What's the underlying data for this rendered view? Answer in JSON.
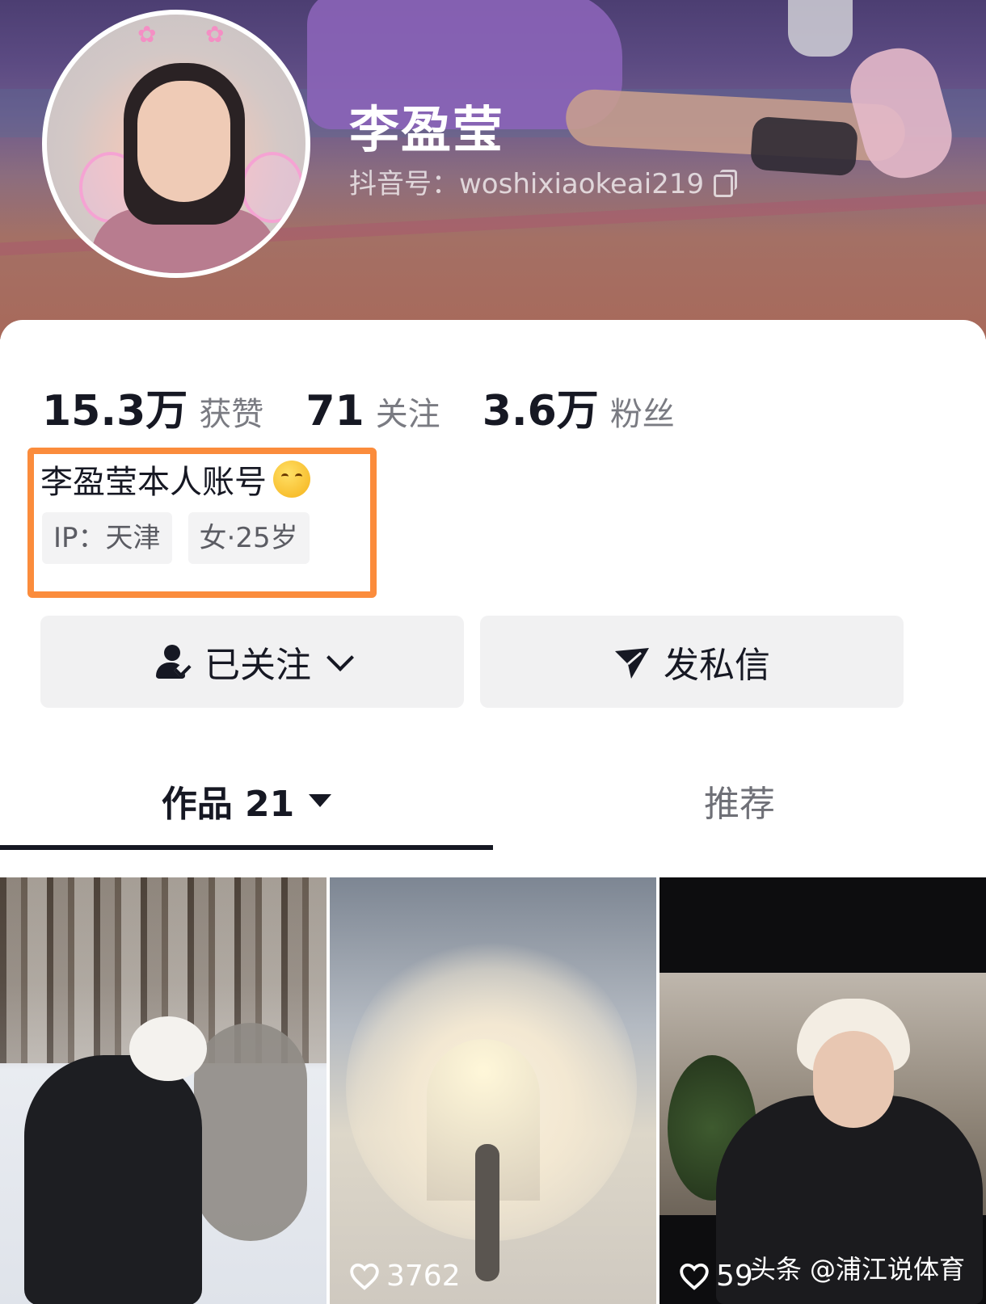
{
  "profile": {
    "name": "李盈莹",
    "douyin_id": "抖音号：woshixiaokeai219",
    "bio": "李盈莹本人账号"
  },
  "stats": [
    {
      "value": "15.3万",
      "label": "获赞"
    },
    {
      "value": "71",
      "label": "关注"
    },
    {
      "value": "3.6万",
      "label": "粉丝"
    }
  ],
  "tags": [
    {
      "text": "IP：天津"
    },
    {
      "text": "女·25岁"
    }
  ],
  "buttons": {
    "follow_label": "已关注",
    "message_label": "发私信"
  },
  "tabs": [
    {
      "label": "作品 21",
      "active": true
    },
    {
      "label": "推荐",
      "active": false
    }
  ],
  "videos": [
    {
      "likes": ""
    },
    {
      "likes": "3762"
    },
    {
      "likes": "59"
    }
  ],
  "watermark": "头条 @浦江说体育",
  "colors": {
    "highlight_box": "#fb8c3c",
    "text_primary": "#161823",
    "text_secondary": "#7a7b82",
    "button_bg": "#f1f1f2"
  },
  "icons": [
    "copy-icon",
    "emoji-smile-icon",
    "person-check-icon",
    "chevron-down-icon",
    "send-icon",
    "caret-down-icon",
    "heart-icon"
  ]
}
